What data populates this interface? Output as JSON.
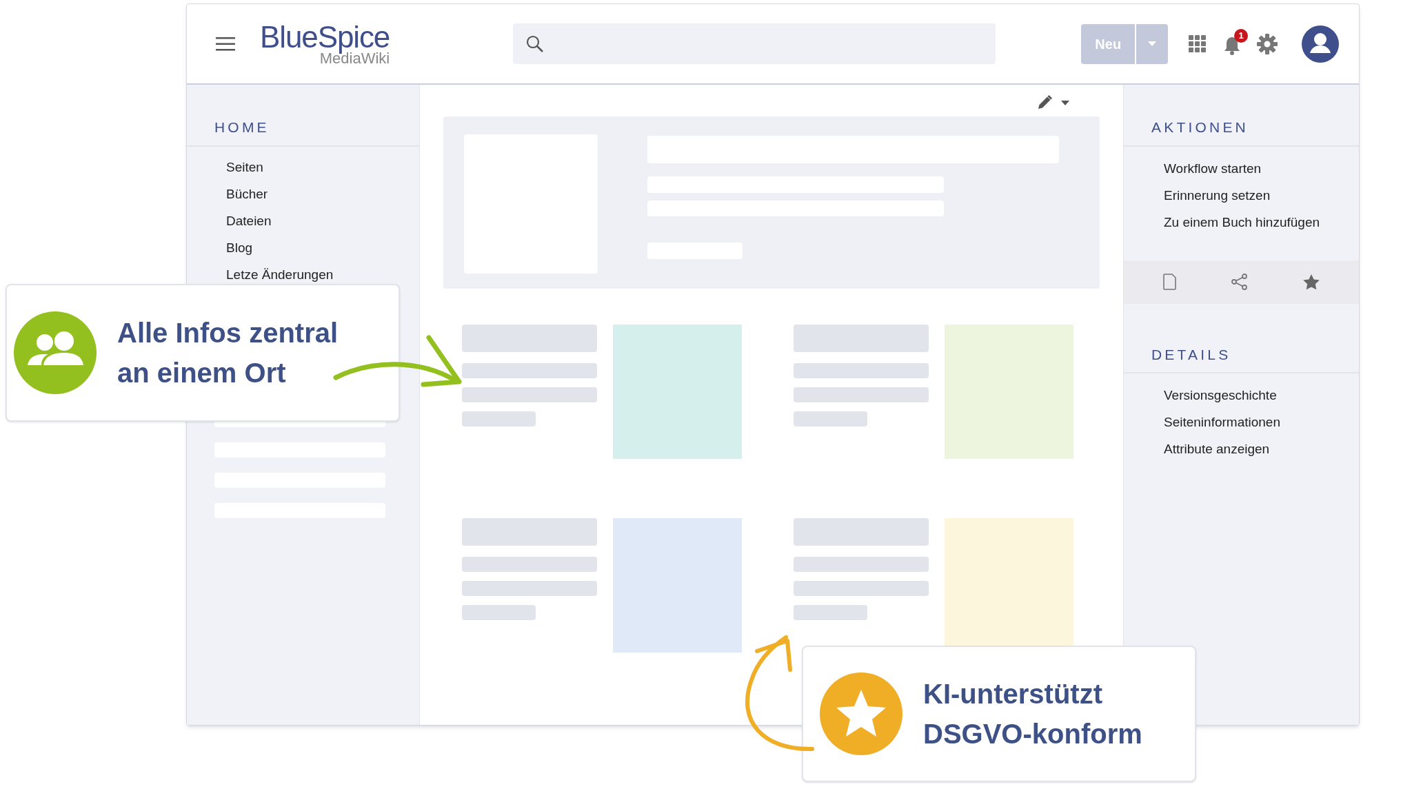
{
  "header": {
    "logo": "BlueSpice",
    "logo_subtitle": "MediaWiki",
    "new_button": "Neu",
    "notification_count": "1"
  },
  "left_sidebar": {
    "heading": "HOME",
    "items": [
      "Seiten",
      "Bücher",
      "Dateien",
      "Blog",
      "Letze Änderungen"
    ]
  },
  "content": {
    "tiles": [
      {
        "color": "#d4efec"
      },
      {
        "color": "#eef5de"
      },
      {
        "color": "#dfe9f8"
      },
      {
        "color": "#fcf6dc"
      }
    ]
  },
  "right_sidebar": {
    "sections": [
      {
        "heading": "AKTIONEN",
        "items": [
          "Workflow starten",
          "Erinnerung setzen",
          "Zu einem Buch hinzufügen"
        ]
      },
      {
        "heading": "DETAILS",
        "items": [
          "Versionsgeschichte",
          "Seiteninformationen",
          "Attribute anzeigen"
        ]
      }
    ]
  },
  "callouts": [
    {
      "kind": "people",
      "color": "#93c01f",
      "lines": [
        "Alle Infos zentral",
        "an einem Ort"
      ]
    },
    {
      "kind": "star",
      "color": "#f0ae27",
      "lines": [
        "KI-unterstützt",
        "DSGVO-konform"
      ]
    }
  ]
}
